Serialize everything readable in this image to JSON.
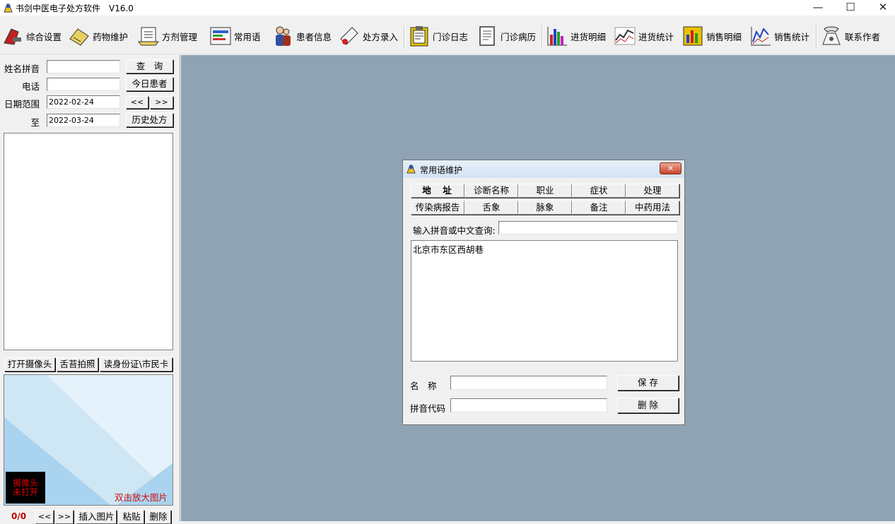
{
  "window": {
    "title": "书剑中医电子处方软件　V16.0",
    "minimize": "—",
    "maximize": "☐",
    "close": "✕"
  },
  "toolbar": [
    {
      "label": "综合设置",
      "icon": "settings-icon"
    },
    {
      "label": "药物维护",
      "icon": "medicine-icon"
    },
    {
      "label": "方剂管理",
      "icon": "formula-icon"
    },
    {
      "label": "常用语",
      "icon": "phrases-icon"
    },
    {
      "label": "患者信息",
      "icon": "patient-icon"
    },
    {
      "label": "处方录入",
      "icon": "prescription-icon"
    },
    {
      "label": "门诊日志",
      "icon": "clinic-log-icon"
    },
    {
      "label": "门诊病历",
      "icon": "medical-record-icon"
    },
    {
      "label": "进货明细",
      "icon": "purchase-detail-icon"
    },
    {
      "label": "进货统计",
      "icon": "purchase-stats-icon"
    },
    {
      "label": "销售明细",
      "icon": "sales-detail-icon"
    },
    {
      "label": "销售统计",
      "icon": "sales-stats-icon"
    },
    {
      "label": "联系作者",
      "icon": "contact-icon"
    }
  ],
  "search": {
    "name_label": "姓名拼音",
    "name_value": "",
    "phone_label": "电话",
    "phone_value": "",
    "date_label": "日期范围",
    "date_from": "2022-02-24",
    "to_label": "至",
    "date_to": "2022-03-24",
    "query_button": "查　询",
    "today_button": "今日患者",
    "prev_button": "<<",
    "next_button": ">>",
    "history_button": "历史处方"
  },
  "camera": {
    "open_button": "打开摄像头",
    "tongue_button": "舌苔拍照",
    "idcard_button": "读身份证\\市民卡",
    "status": "摄像头\n未打开",
    "zoom_hint": "双击放大图片",
    "counter": "0/0",
    "prev": "<<",
    "next": ">>",
    "insert_button": "插入图片",
    "paste_button": "粘贴",
    "delete_button": "删除"
  },
  "dialog": {
    "title": "常用语维护",
    "tabs_row1": [
      "地　址",
      "诊断名称",
      "职业",
      "症状",
      "处理"
    ],
    "tabs_row2": [
      "传染病报告",
      "舌象",
      "脉象",
      "备注",
      "中药用法"
    ],
    "query_label": "输入拼音或中文查询:",
    "query_value": "",
    "list": [
      "北京市东区西胡巷"
    ],
    "name_label": "名　称",
    "name_value": "",
    "pinyin_label": "拼音代码",
    "pinyin_value": "",
    "save_button": "保 存",
    "delete_button": "删 除"
  },
  "colors": {
    "mdi_background": "#8fa3b4",
    "camera_status_text": "#e00000",
    "zoom_hint_text": "#d01010"
  }
}
